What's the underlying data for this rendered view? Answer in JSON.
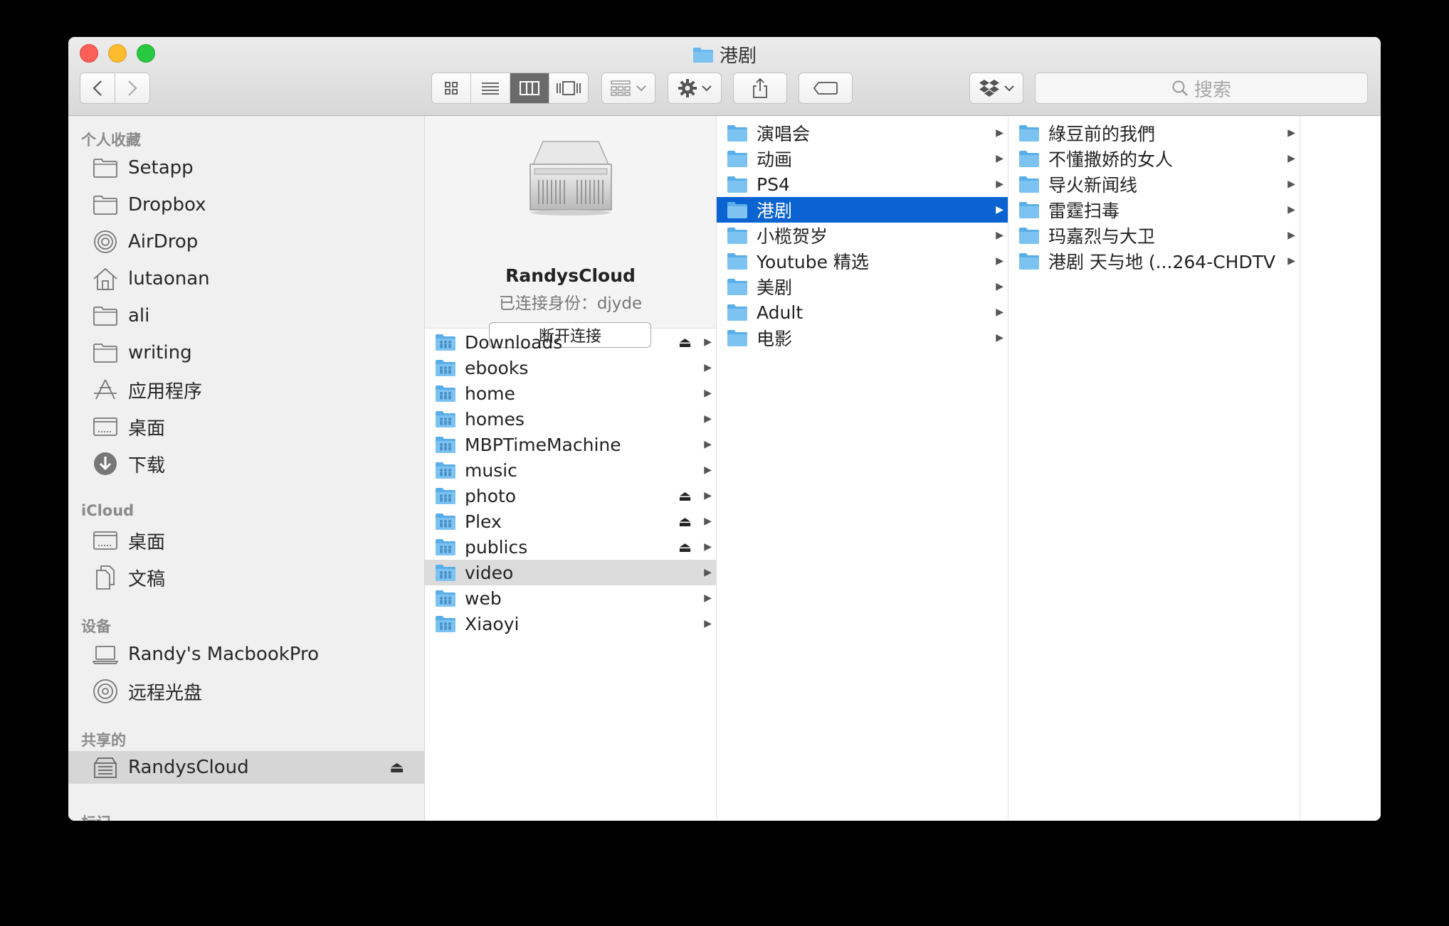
{
  "window": {
    "title": "港剧"
  },
  "toolbar": {
    "views": [
      "icon",
      "list",
      "column",
      "cover-flow"
    ],
    "active_view": "column",
    "search_placeholder": "搜索"
  },
  "sidebar": {
    "favorites_header": "个人收藏",
    "favorites": [
      {
        "label": "Setapp",
        "icon": "folder-icon"
      },
      {
        "label": "Dropbox",
        "icon": "folder-icon"
      },
      {
        "label": "AirDrop",
        "icon": "airdrop-icon"
      },
      {
        "label": "lutaonan",
        "icon": "home-icon"
      },
      {
        "label": "ali",
        "icon": "folder-icon"
      },
      {
        "label": "writing",
        "icon": "folder-icon"
      },
      {
        "label": "应用程序",
        "icon": "applications-icon"
      },
      {
        "label": "桌面",
        "icon": "desktop-icon"
      },
      {
        "label": "下载",
        "icon": "downloads-icon"
      }
    ],
    "icloud_header": "iCloud",
    "icloud": [
      {
        "label": "桌面",
        "icon": "desktop-icon"
      },
      {
        "label": "文稿",
        "icon": "documents-icon"
      }
    ],
    "devices_header": "设备",
    "devices": [
      {
        "label": "Randy's MacbookPro",
        "icon": "laptop-icon"
      },
      {
        "label": "远程光盘",
        "icon": "disc-icon"
      }
    ],
    "shared_header": "共享的",
    "shared": [
      {
        "label": "RandysCloud",
        "icon": "server-icon",
        "selected": true,
        "eject": "⏏"
      }
    ],
    "tags_header": "标记"
  },
  "server": {
    "name": "RandysCloud",
    "connected_as": "已连接身份：djyde",
    "disconnect_label": "断开连接"
  },
  "column1": [
    {
      "label": "Downloads",
      "eject": "⏏"
    },
    {
      "label": "ebooks"
    },
    {
      "label": "home"
    },
    {
      "label": "homes"
    },
    {
      "label": "MBPTimeMachine"
    },
    {
      "label": "music"
    },
    {
      "label": "photo",
      "eject": "⏏"
    },
    {
      "label": "Plex",
      "eject": "⏏"
    },
    {
      "label": "publics",
      "eject": "⏏"
    },
    {
      "label": "video",
      "highlighted": true
    },
    {
      "label": "web"
    },
    {
      "label": "Xiaoyi"
    }
  ],
  "column2": [
    {
      "label": "演唱会"
    },
    {
      "label": "动画"
    },
    {
      "label": "PS4"
    },
    {
      "label": "港剧",
      "selected": true
    },
    {
      "label": "小榄贺岁"
    },
    {
      "label": "Youtube 精选"
    },
    {
      "label": "美剧"
    },
    {
      "label": "Adult"
    },
    {
      "label": "电影"
    }
  ],
  "column3": [
    {
      "label": "綠豆前的我們"
    },
    {
      "label": "不懂撒娇的女人"
    },
    {
      "label": "导火新闻线"
    },
    {
      "label": "雷霆扫毒"
    },
    {
      "label": "玛嘉烈与大卫"
    },
    {
      "label": "港剧 天与地 (...264-CHDTV"
    }
  ],
  "colors": {
    "selection": "#0b63d1",
    "folder": "#67b6ee",
    "sidebar": "#f0f0f0"
  }
}
